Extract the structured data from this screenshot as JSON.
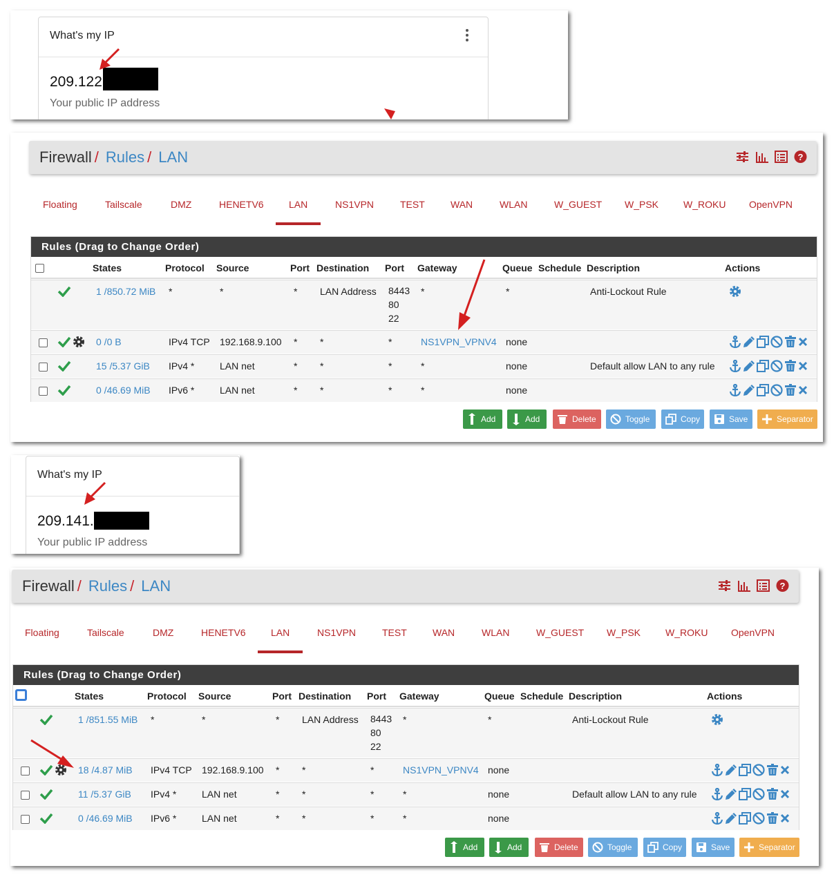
{
  "widget1": {
    "title": "What's my IP",
    "ip_prefix": "209.122",
    "subtitle": "Your public IP address"
  },
  "widget2": {
    "title": "What's my IP",
    "ip_prefix": "209.141.",
    "subtitle": "Your public IP address"
  },
  "breadcrumb": {
    "root": "Firewall",
    "rules": "Rules",
    "lan": "LAN"
  },
  "tabs": [
    "Floating",
    "Tailscale",
    "DMZ",
    "HENETV6",
    "LAN",
    "NS1VPN",
    "TEST",
    "WAN",
    "WLAN",
    "W_GUEST",
    "W_PSK",
    "W_ROKU",
    "OpenVPN"
  ],
  "active_tab": "LAN",
  "panel_title": "Rules (Drag to Change Order)",
  "columns": [
    "States",
    "Protocol",
    "Source",
    "Port",
    "Destination",
    "Port",
    "Gateway",
    "Queue",
    "Schedule",
    "Description",
    "Actions"
  ],
  "rules1": [
    {
      "states": "1 /850.72 MiB",
      "protocol": "*",
      "source": "*",
      "sport": "*",
      "dest": "LAN Address",
      "dport": [
        "8443",
        "80",
        "22"
      ],
      "gateway": "*",
      "queue": "*",
      "schedule": "",
      "description": "Anti-Lockout Rule"
    },
    {
      "states": "0 /0 B",
      "protocol": "IPv4 TCP",
      "source": "192.168.9.100",
      "sport": "*",
      "dest": "*",
      "dport": [
        "*"
      ],
      "gateway": "NS1VPN_VPNV4",
      "queue": "none",
      "schedule": "",
      "description": ""
    },
    {
      "states": "15 /5.37 GiB",
      "protocol": "IPv4 *",
      "source": "LAN net",
      "sport": "*",
      "dest": "*",
      "dport": [
        "*"
      ],
      "gateway": "*",
      "queue": "none",
      "schedule": "",
      "description": "Default allow LAN to any rule"
    },
    {
      "states": "0 /46.69 MiB",
      "protocol": "IPv6 *",
      "source": "LAN net",
      "sport": "*",
      "dest": "*",
      "dport": [
        "*"
      ],
      "gateway": "*",
      "queue": "none",
      "schedule": "",
      "description": ""
    }
  ],
  "rules2": [
    {
      "states": "1 /851.55 MiB",
      "protocol": "*",
      "source": "*",
      "sport": "*",
      "dest": "LAN Address",
      "dport": [
        "8443",
        "80",
        "22"
      ],
      "gateway": "*",
      "queue": "*",
      "schedule": "",
      "description": "Anti-Lockout Rule"
    },
    {
      "states": "18 /4.87 MiB",
      "protocol": "IPv4 TCP",
      "source": "192.168.9.100",
      "sport": "*",
      "dest": "*",
      "dport": [
        "*"
      ],
      "gateway": "NS1VPN_VPNV4",
      "queue": "none",
      "schedule": "",
      "description": ""
    },
    {
      "states": "11 /5.37 GiB",
      "protocol": "IPv4 *",
      "source": "LAN net",
      "sport": "*",
      "dest": "*",
      "dport": [
        "*"
      ],
      "gateway": "*",
      "queue": "none",
      "schedule": "",
      "description": "Default allow LAN to any rule"
    },
    {
      "states": "0 /46.69 MiB",
      "protocol": "IPv6 *",
      "source": "LAN net",
      "sport": "*",
      "dest": "*",
      "dport": [
        "*"
      ],
      "gateway": "*",
      "queue": "none",
      "schedule": "",
      "description": ""
    }
  ],
  "buttons": {
    "add_top": "Add",
    "add_bottom": "Add",
    "delete": "Delete",
    "toggle": "Toggle",
    "copy": "Copy",
    "save": "Save",
    "separator": "Separator"
  },
  "colors": {
    "brand_red": "#b62629",
    "link_blue": "#3c87c4",
    "pass_green": "#2e9e4b",
    "panel_dark": "#3e3e3e"
  },
  "icons": [
    "kebab-menu-icon",
    "sliders-icon",
    "bar-chart-icon",
    "list-icon",
    "help-icon",
    "check-icon",
    "gear-icon",
    "anchor-icon",
    "pencil-icon",
    "copy-icon",
    "block-icon",
    "trash-icon",
    "close-icon",
    "arrow-icon"
  ]
}
